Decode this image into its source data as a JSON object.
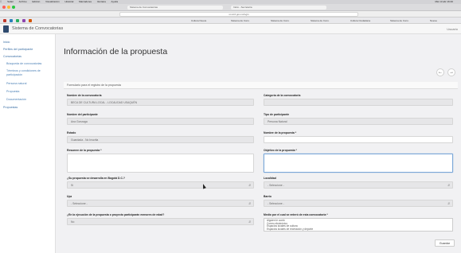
{
  "browser": {
    "menu": [
      "Safari",
      "Archivo",
      "Edición",
      "Visualización",
      "Historial",
      "Marcadores",
      "Ventana",
      "Ayuda"
    ],
    "clock": "Mié 13 abr 16:40",
    "url": "si.scrd.gov.co/login",
    "tabs": [
      "Sistema de Convocatorias",
      "Inicio - Secretaría"
    ],
    "bookmarks": [
      "Cultura Nueva",
      "Sistema de Conv.",
      "Sistema de Conv.",
      "Sistema de Conv.",
      "Cultura Ciudadana",
      "Sistema de Conv.",
      "Nueva"
    ]
  },
  "app": {
    "title": "Sistema de Convocatorias",
    "user": "Usuario"
  },
  "sidebar": {
    "items": [
      {
        "label": "Inicio"
      },
      {
        "label": "Perfiles del participante"
      },
      {
        "label": "Convocatorias"
      },
      {
        "label": "Búsqueda de convocatorias",
        "sub": true
      },
      {
        "label": "Términos y condiciones de",
        "sub": true
      },
      {
        "label": "participación",
        "sub": true
      },
      {
        "label": "Persona natural",
        "sub": true
      },
      {
        "label": "Propuesta",
        "sub": true
      },
      {
        "label": "Documentación",
        "sub": true
      },
      {
        "label": "Propuestas"
      }
    ]
  },
  "page": {
    "title": "Información de la propuesta",
    "form_title": "Formulario para el registro de la propuesta",
    "save_label": "Guardar"
  },
  "fields": {
    "convocatoria": {
      "label": "Nombre de la convocatoria",
      "value": "BECA DE CULTURA LOCAL - LOCALIDAD USAQUÉN"
    },
    "categoria": {
      "label": "Categoría de la convocatoria",
      "value": ""
    },
    "participante": {
      "label": "Nombre del participante",
      "value": "Ana Gonzaga"
    },
    "tipo": {
      "label": "Tipo de participante",
      "value": "Persona Natural"
    },
    "estado": {
      "label": "Estado",
      "value": "Guardada - No Inscrita"
    },
    "nombre_propuesta": {
      "label": "Nombre de la propuesta *",
      "value": ""
    },
    "resumen": {
      "label": "Resumen de la propuesta *",
      "value": ""
    },
    "objetivo": {
      "label": "Objetivo de la propuesta *",
      "value": ""
    },
    "bogota": {
      "label": "¿Su propuesta se desarrolla en Bogotá D.C.?",
      "value": "Sí"
    },
    "localidad": {
      "label": "Localidad",
      "value": "- Seleccione -"
    },
    "upz": {
      "label": "Upz",
      "value": "- Seleccione -"
    },
    "barrio": {
      "label": "Barrio",
      "value": "- Seleccione -"
    },
    "ejecucion": {
      "label": "¿En la ejecución de la propuesta o proyecto participarán menores de edad?",
      "value": "No"
    },
    "medio": {
      "label": "Medio por el cual se enteró de esta convocatoria *",
      "options": [
        "Alguien le contó",
        "Correo electrónico",
        "Espacios locales de cultura",
        "Espacios locales de recreación y deporte"
      ]
    }
  }
}
